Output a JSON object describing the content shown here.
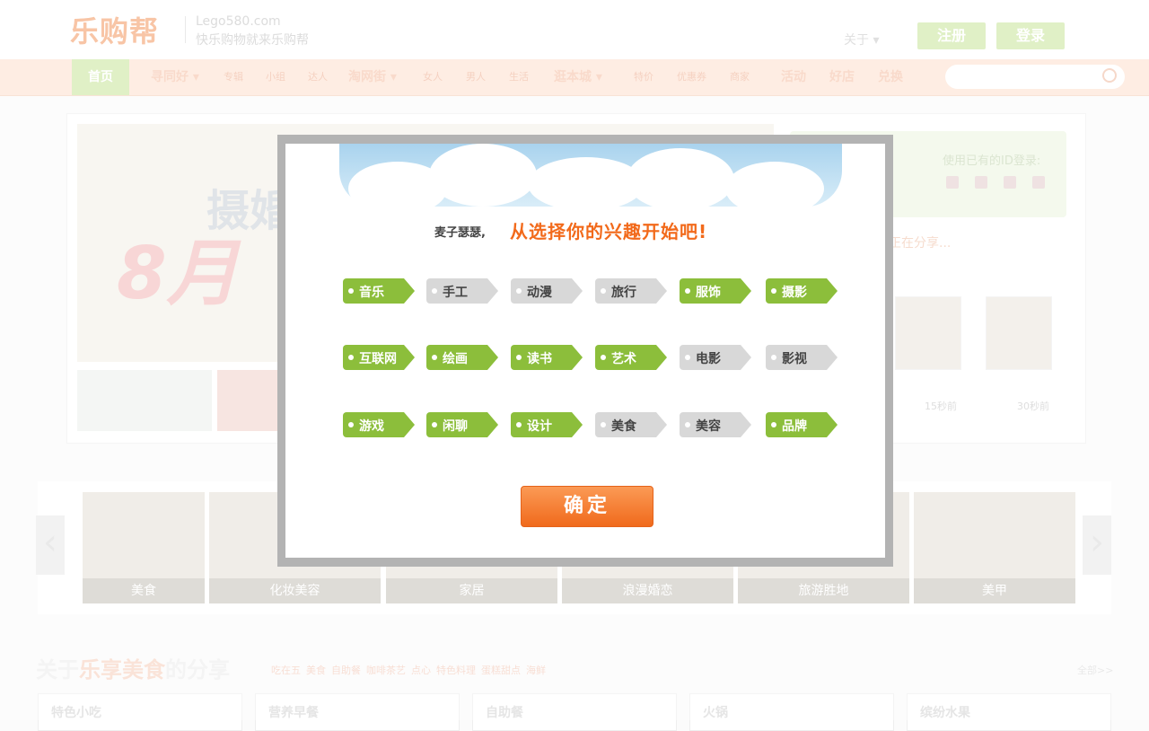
{
  "header": {
    "logo": "乐购帮",
    "domain": "Lego580.com",
    "slogan": "快乐购物就来乐购帮",
    "about": "关于 ▾",
    "register": "注册",
    "login": "登录"
  },
  "nav": {
    "home": "首页",
    "items": [
      {
        "label": "寻同好 ▾",
        "big": true
      },
      {
        "label": "专辑"
      },
      {
        "label": "小组"
      },
      {
        "label": "达人"
      },
      {
        "label": "淘网街 ▾",
        "big": true
      },
      {
        "label": "女人"
      },
      {
        "label": "男人"
      },
      {
        "label": "生活"
      },
      {
        "label": "逛本城 ▾",
        "big": true
      },
      {
        "label": "特价"
      },
      {
        "label": "优惠券"
      },
      {
        "label": "商家"
      },
      {
        "label": "活动",
        "big": true
      },
      {
        "label": "好店",
        "big": true
      },
      {
        "label": "兑换",
        "big": true
      }
    ]
  },
  "banner": {
    "text1": "摄婚",
    "text2": "8月"
  },
  "side": {
    "login_hint": "使用已有的ID登录:",
    "sharing": "正在分享...",
    "times": [
      "15秒前",
      "30秒前"
    ]
  },
  "carousel": {
    "prev": "‹",
    "next": "›",
    "tiles": [
      "美食",
      "化妆美容",
      "家居",
      "浪漫婚恋",
      "旅游胜地",
      "美甲"
    ]
  },
  "section": {
    "title_pre": "关于",
    "title_hl": "乐享美食",
    "title_post": "的分享",
    "tags": [
      "吃在五",
      "美食",
      "自助餐",
      "咖啡茶艺",
      "点心",
      "特色料理",
      "蛋糕甜点",
      "海鲜"
    ],
    "all": "全部>>",
    "categories": [
      "特色小吃",
      "营养早餐",
      "自助餐",
      "火锅",
      "缤纷水果"
    ]
  },
  "modal": {
    "greet_name": "麦子瑟瑟,",
    "greet_msg": "从选择你的兴趣开始吧!",
    "confirm": "确定",
    "tags": [
      {
        "label": "音乐",
        "selected": true
      },
      {
        "label": "手工",
        "selected": false
      },
      {
        "label": "动漫",
        "selected": false
      },
      {
        "label": "旅行",
        "selected": false
      },
      {
        "label": "服饰",
        "selected": true
      },
      {
        "label": "摄影",
        "selected": true
      },
      {
        "label": "互联网",
        "selected": true
      },
      {
        "label": "绘画",
        "selected": true
      },
      {
        "label": "读书",
        "selected": true
      },
      {
        "label": "艺术",
        "selected": true
      },
      {
        "label": "电影",
        "selected": false
      },
      {
        "label": "影视",
        "selected": false
      },
      {
        "label": "游戏",
        "selected": true
      },
      {
        "label": "闲聊",
        "selected": true
      },
      {
        "label": "设计",
        "selected": true
      },
      {
        "label": "美食",
        "selected": false
      },
      {
        "label": "美容",
        "selected": false
      },
      {
        "label": "品牌",
        "selected": true
      }
    ]
  }
}
